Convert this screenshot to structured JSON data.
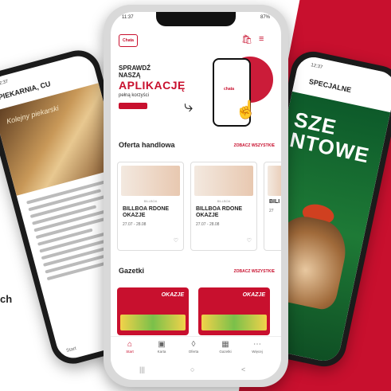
{
  "side_text": "ch",
  "left_phone": {
    "time": "12:37",
    "title": "PIEKARNIA, CU",
    "image_caption": "Kolejny piekarski",
    "nav_label": "Start"
  },
  "right_phone": {
    "time": "12:37",
    "title": "SPECJALNE",
    "big_text": "SZE\nNTOWE"
  },
  "center_phone": {
    "status_time": "11:37",
    "status_right": "87%",
    "logo": "Chata",
    "banner": {
      "line1": "SPRAWDŹ",
      "line2": "NASZĄ",
      "headline": "APLIKACJĘ",
      "sub": "pełną korzyści",
      "mini_logo": "chata"
    },
    "offer_section": {
      "title": "Oferta handlowa",
      "see_all": "ZOBACZ WSZYSTKIE",
      "cards": [
        {
          "small": "BILLBOA",
          "name": "BILLBOA RDONE OKAZJE",
          "date": "27.07 - 28.08"
        },
        {
          "small": "BILLBOA",
          "name": "BILLBOA RDONE OKAZJE",
          "date": "27.07 - 28.08"
        },
        {
          "small": "",
          "name": "BILI",
          "date": "27"
        }
      ]
    },
    "gazetki_section": {
      "title": "Gazetki",
      "see_all": "ZOBACZ WSZYSTKIE",
      "cards": [
        {
          "label": "OKAZJE"
        },
        {
          "label": "OKAZJE"
        }
      ]
    },
    "bottom_nav": [
      {
        "label": "Start",
        "icon": "home-icon",
        "active": true
      },
      {
        "label": "Karta",
        "icon": "card-icon",
        "active": false
      },
      {
        "label": "Oferta",
        "icon": "tag-icon",
        "active": false
      },
      {
        "label": "Gazetki",
        "icon": "newspaper-icon",
        "active": false
      },
      {
        "label": "Więcej",
        "icon": "more-icon",
        "active": false
      }
    ],
    "system_nav": [
      "|||",
      "○",
      "<"
    ]
  },
  "colors": {
    "brand_red": "#c8102e",
    "green": "#1e7a36"
  }
}
